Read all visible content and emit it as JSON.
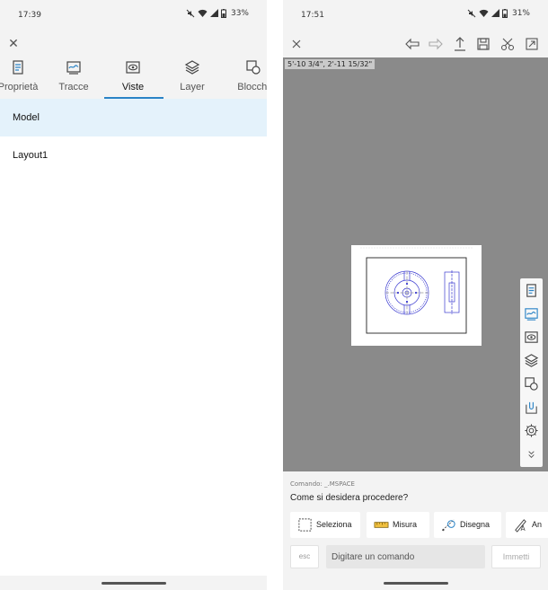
{
  "left": {
    "status": {
      "time": "17:39",
      "battery": "33%"
    },
    "tabs": [
      {
        "label": "Proprietà",
        "icon": "properties-icon"
      },
      {
        "label": "Tracce",
        "icon": "traces-icon"
      },
      {
        "label": "Viste",
        "icon": "views-icon",
        "active": true
      },
      {
        "label": "Layer",
        "icon": "layers-icon"
      },
      {
        "label": "Blocchi",
        "icon": "blocks-icon"
      }
    ],
    "views": [
      "Model",
      "Layout1"
    ]
  },
  "right": {
    "status": {
      "time": "17:51",
      "battery": "31%"
    },
    "coordinates": "5'-10 3/4\", 2'-11 15/32\"",
    "command": {
      "history": "Comando: _.MSPACE",
      "prompt": "Come si desidera procedere?",
      "chips": [
        {
          "label": "Seleziona",
          "icon": "select-icon"
        },
        {
          "label": "Misura",
          "icon": "ruler-icon"
        },
        {
          "label": "Disegna",
          "icon": "draw-icon"
        },
        {
          "label": "An",
          "icon": "annotate-icon"
        }
      ],
      "esc_label": "esc",
      "input_placeholder": "Digitare un comando",
      "submit_label": "Immetti"
    }
  },
  "colors": {
    "accent": "#2a83c6",
    "selected_row": "#e4f2fb",
    "canvas": "#8a8a8a",
    "drawing_lines": "#3a3ad0"
  }
}
